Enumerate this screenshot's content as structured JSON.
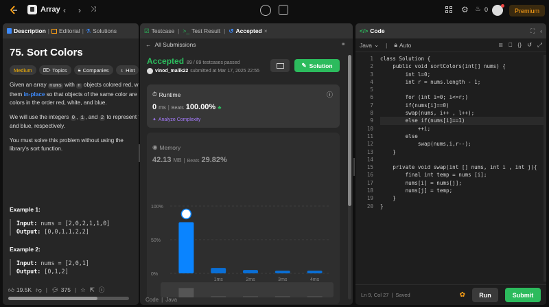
{
  "topbar": {
    "problem_list_label": "Array",
    "premium_label": "Premium",
    "streak_count": "0"
  },
  "left": {
    "tabs": [
      {
        "label": "Description"
      },
      {
        "label": "Editorial"
      },
      {
        "label": "Solutions"
      }
    ],
    "title": "75. Sort Colors",
    "tags": {
      "difficulty": "Medium",
      "topics": "Topics",
      "companies": "Companies",
      "hint": "Hint"
    },
    "para1": {
      "t1": "Given an array ",
      "c1": "nums",
      "t2": " with ",
      "c2": "n",
      "t3": " objects colored red, white, or blue, sort them ",
      "link": "in-place",
      "t4": " so that objects of the same color are adjacent, with the colors in the order red, white, and blue."
    },
    "para2": {
      "t1": "We will use the integers ",
      "c1": "0",
      "t2": ", ",
      "c2": "1",
      "t3": ", and ",
      "c3": "2",
      "t4": " to represent the color red, white, and blue, respectively."
    },
    "para3": "You must solve this problem without using the library's sort function.",
    "examples": [
      {
        "heading": "Example 1:",
        "input_label": "Input:",
        "input": "nums = [2,0,2,1,1,0]",
        "output_label": "Output:",
        "output": "[0,0,1,1,2,2]"
      },
      {
        "heading": "Example 2:",
        "input_label": "Input:",
        "input": "nums = [2,0,1]",
        "output_label": "Output:",
        "output": "[0,1,2]"
      }
    ],
    "footer": {
      "likes": "19.5K",
      "comments": "375"
    }
  },
  "middle": {
    "tabs": [
      {
        "label": "Testcase"
      },
      {
        "label": "Test Result"
      },
      {
        "label": "Accepted"
      }
    ],
    "back_label": "All Submissions",
    "status": "Accepted",
    "passed": "89 / 89 testcases passed",
    "user": "vinod_malik22",
    "submitted": "submitted at Mar 17, 2025 22:55",
    "solution_label": "Solution",
    "runtime": {
      "label": "Runtime",
      "value": "0",
      "unit": "ms",
      "beats_label": "Beats",
      "beats": "100.00%",
      "analyze": "Analyze Complexity"
    },
    "memory": {
      "label": "Memory",
      "value": "42.13",
      "unit": "MB",
      "beats_label": "Beats",
      "beats": "29.82%"
    },
    "code_footer": "Code",
    "lang_footer": "Java"
  },
  "chart_data": {
    "type": "bar",
    "categories": [
      "",
      "1ms",
      "2ms",
      "3ms",
      "4ms"
    ],
    "values": [
      76,
      8,
      5,
      4,
      4
    ],
    "y_tick_labels": [
      "100%",
      "50%",
      "0%"
    ],
    "ylim": [
      0,
      100
    ],
    "highlighted_index": 0
  },
  "editor": {
    "tab_label": "Code",
    "language": "Java",
    "auto_label": "Auto",
    "status": "Ln 9, Col 27",
    "saved": "Saved",
    "run_label": "Run",
    "submit_label": "Submit",
    "lines": [
      "class Solution {",
      "    public void sortColors(int[] nums) {",
      "        int l=0;",
      "        int r = nums.length - 1;",
      "",
      "        for (int i=0; i<=r;)",
      "        if(nums[i]==0)",
      "        swap(nums, i++ , l++);",
      "        else if(nums[i]==1)",
      "            ++i;",
      "        else",
      "            swap(nums,i,r--);",
      "    }",
      "",
      "    private void swap(int [] nums, int i , int j){",
      "        final int temp = nums [i];",
      "        nums[i] = nums[j];",
      "        nums[j] = temp;",
      "    }",
      "}"
    ],
    "line_numbers": [
      "1",
      "2",
      "3",
      "4",
      "5",
      "6",
      "7",
      "8",
      "9",
      "10",
      "11",
      "12",
      "13",
      "14",
      "15",
      "16",
      "17",
      "18",
      "19",
      "20"
    ]
  }
}
